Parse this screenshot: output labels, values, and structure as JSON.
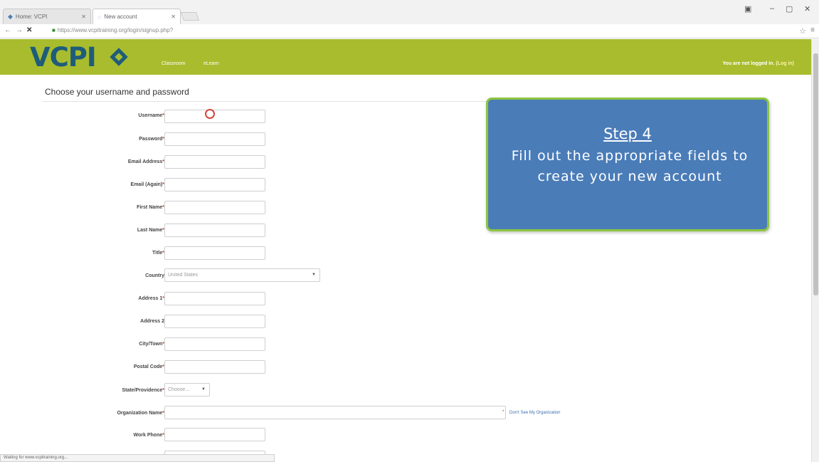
{
  "browser": {
    "tabs": [
      {
        "label": "Home: VCPI",
        "active": false
      },
      {
        "label": "New account",
        "active": true
      }
    ],
    "url": "https://www.vcpitraining.org/login/signup.php?",
    "status": "Waiting for www.vcpitraining.org...",
    "window_controls": [
      "▣",
      "–",
      "▢",
      "✕"
    ]
  },
  "site": {
    "logo": "VCPI",
    "nav": [
      "Classroom",
      "eLearn"
    ],
    "login_prefix": "You are not logged in.",
    "login_link": "(Log in)"
  },
  "form": {
    "title": "Choose your username and password",
    "fields": [
      {
        "label": "Username",
        "required": true,
        "type": "text"
      },
      {
        "label": "Password",
        "required": true,
        "type": "text"
      },
      {
        "label": "Email Address",
        "required": true,
        "type": "text"
      },
      {
        "label": "Email (Again)",
        "required": true,
        "type": "text"
      },
      {
        "label": "First Name",
        "required": true,
        "type": "text"
      },
      {
        "label": "Last Name",
        "required": true,
        "type": "text"
      },
      {
        "label": "Title",
        "required": true,
        "type": "text"
      },
      {
        "label": "Country",
        "required": false,
        "type": "select",
        "value": "United States"
      },
      {
        "label": "Address 1",
        "required": true,
        "type": "text"
      },
      {
        "label": "Address 2",
        "required": false,
        "type": "text"
      },
      {
        "label": "City/Town",
        "required": true,
        "type": "text"
      },
      {
        "label": "Postal Code",
        "required": true,
        "type": "text"
      },
      {
        "label": "State/Providence",
        "required": true,
        "type": "select",
        "value": "Choose..."
      },
      {
        "label": "Organization Name",
        "required": true,
        "type": "select",
        "value": ""
      },
      {
        "label": "Work Phone",
        "required": true,
        "type": "text"
      }
    ],
    "org_link": "Don't See My Organization"
  },
  "callout": {
    "title": "Step 4",
    "body": "Fill out the appropriate fields to create your new account"
  },
  "colors": {
    "header_bg": "#a8bc2d",
    "logo": "#1f5c7a",
    "callout_bg": "#4a7cb8",
    "callout_border": "#8cc63f",
    "required": "#c0392b"
  }
}
